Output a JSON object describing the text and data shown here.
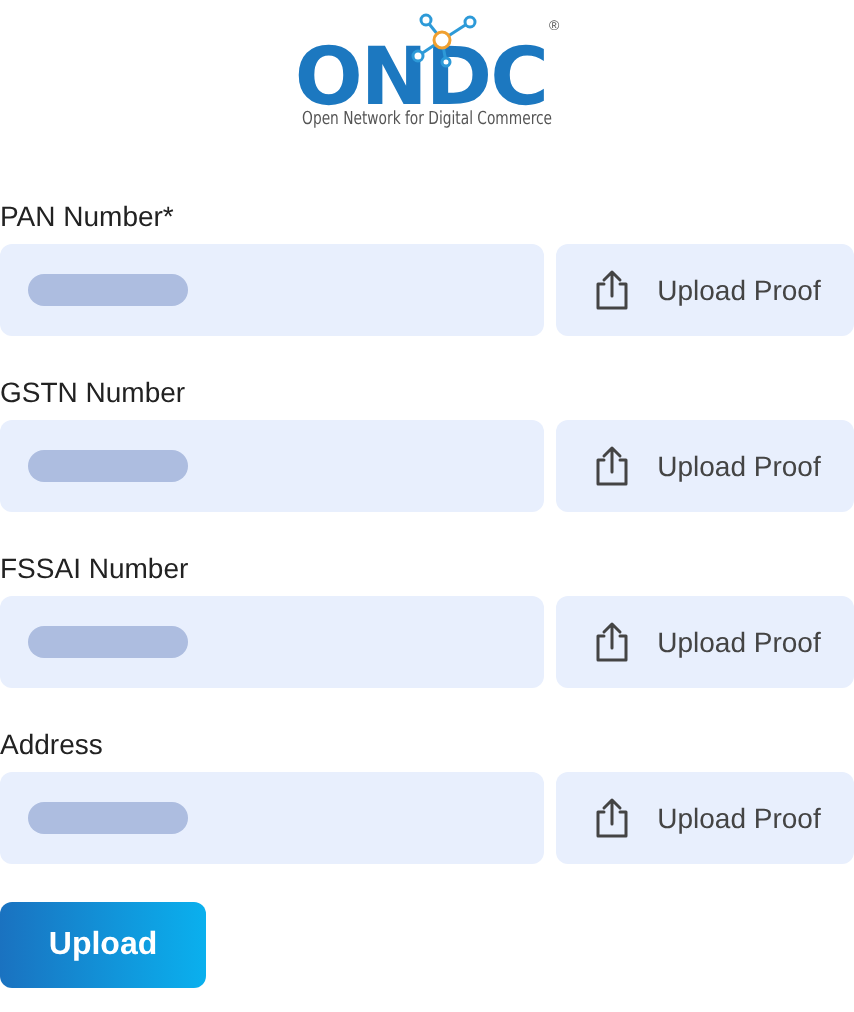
{
  "logo": {
    "wordmark": "ONDC",
    "registered": "®",
    "tagline": "Open Network for Digital Commerce"
  },
  "fields": [
    {
      "label": "PAN Number*",
      "button": "Upload Proof"
    },
    {
      "label": "GSTN Number",
      "button": "Upload Proof"
    },
    {
      "label": "FSSAI Number",
      "button": "Upload Proof"
    },
    {
      "label": "Address",
      "button": "Upload Proof"
    }
  ],
  "submit": "Upload"
}
